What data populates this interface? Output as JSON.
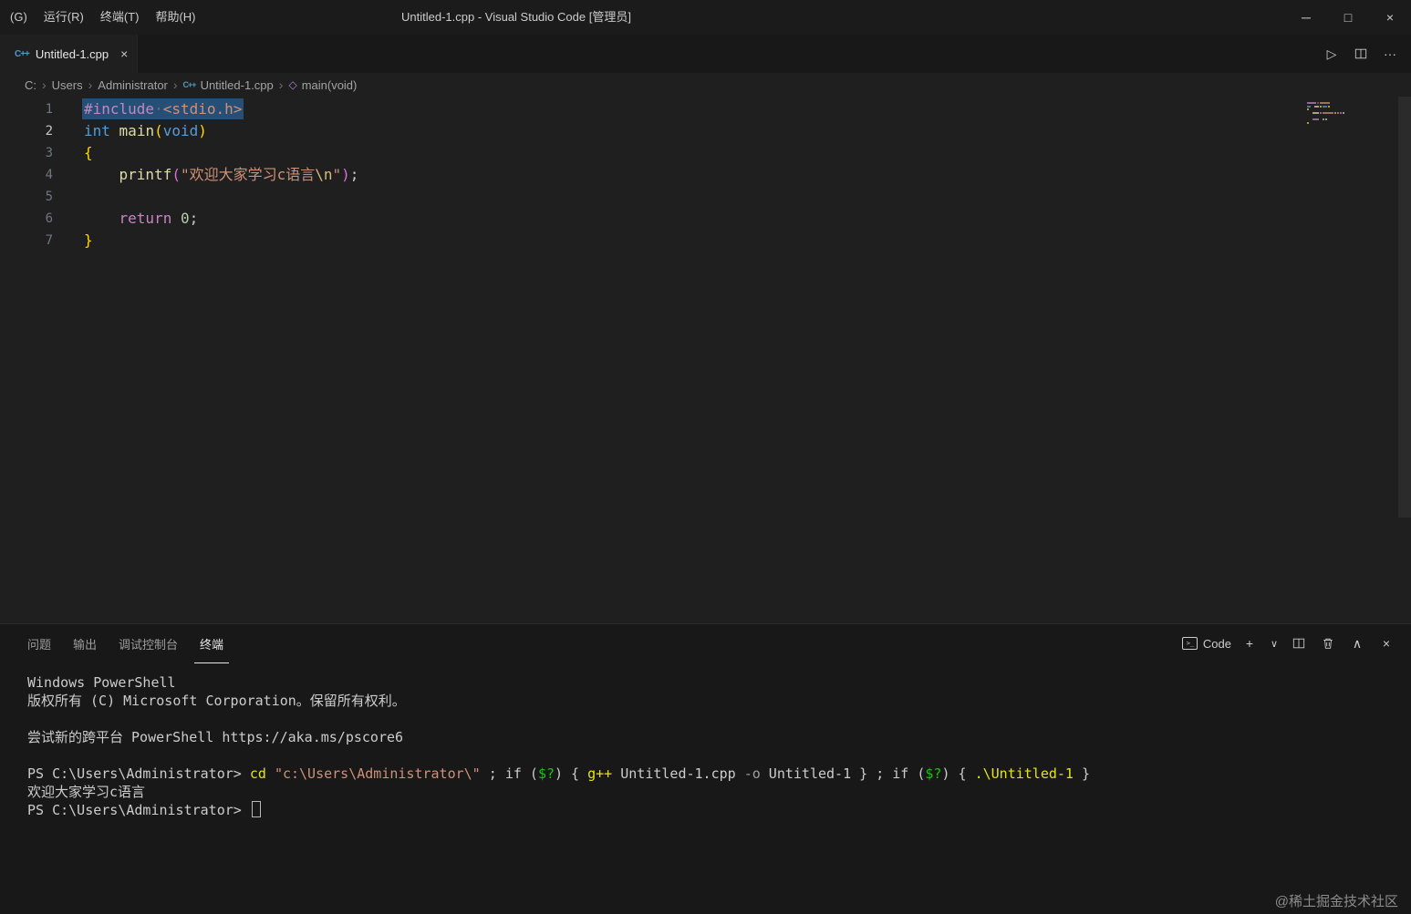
{
  "icons": {
    "cpp": "C++",
    "method": "◇",
    "separator": "›",
    "terminal_glyph": ">_"
  },
  "title_bar": {
    "menus": [
      {
        "label": "(G)"
      },
      {
        "label": "运行(R)"
      },
      {
        "label": "终端(T)"
      },
      {
        "label": "帮助(H)"
      }
    ],
    "title": "Untitled-1.cpp - Visual Studio Code [管理员]",
    "controls": {
      "minimize": "─",
      "maximize": "□",
      "close": "×"
    }
  },
  "tab_bar": {
    "tabs": [
      {
        "label": "Untitled-1.cpp",
        "icon": "cpp",
        "close": "×",
        "active": true
      }
    ],
    "actions": {
      "run": "▷",
      "more": "···"
    }
  },
  "breadcrumb": [
    {
      "label": "C:"
    },
    {
      "label": "Users"
    },
    {
      "label": "Administrator"
    },
    {
      "label": "Untitled-1.cpp",
      "icon": "cpp"
    },
    {
      "label": "main(void)",
      "icon": "method"
    }
  ],
  "editor": {
    "token_colors": {
      "macro": "#c586c0",
      "keyword": "#569cd6",
      "control": "#c586c0",
      "function": "#dcdcaa",
      "string": "#ce9178",
      "escape": "#d7ba7d",
      "number": "#b5cea8",
      "plain": "#cccccc",
      "ws": "#6e6e6e",
      "bracket1": "#ffd700",
      "bracket2": "#da70d6"
    },
    "lines": [
      {
        "num": 1,
        "selected": true,
        "tokens": [
          [
            "#include",
            "macro"
          ],
          [
            "·",
            "ws"
          ],
          [
            "<stdio.h>",
            "string"
          ]
        ]
      },
      {
        "num": 2,
        "active": true,
        "tokens": [
          [
            "int",
            "keyword"
          ],
          [
            " ",
            "plain"
          ],
          [
            "main",
            "function"
          ],
          [
            "(",
            "bracket1"
          ],
          [
            "void",
            "keyword"
          ],
          [
            ")",
            "bracket1"
          ]
        ]
      },
      {
        "num": 3,
        "tokens": [
          [
            "{",
            "bracket1"
          ]
        ]
      },
      {
        "num": 4,
        "tokens": [
          [
            "    ",
            "plain"
          ],
          [
            "printf",
            "function"
          ],
          [
            "(",
            "bracket2"
          ],
          [
            "\"欢迎大家学习c语言",
            "string"
          ],
          [
            "\\n",
            "escape"
          ],
          [
            "\"",
            "string"
          ],
          [
            ")",
            "bracket2"
          ],
          [
            ";",
            "plain"
          ]
        ]
      },
      {
        "num": 5,
        "tokens": []
      },
      {
        "num": 6,
        "tokens": [
          [
            "    ",
            "plain"
          ],
          [
            "return",
            "control"
          ],
          [
            " ",
            "plain"
          ],
          [
            "0",
            "number"
          ],
          [
            ";",
            "plain"
          ]
        ]
      },
      {
        "num": 7,
        "tokens": [
          [
            "}",
            "bracket1"
          ]
        ]
      }
    ]
  },
  "panel": {
    "tabs": [
      {
        "id": "problems",
        "label": "问题",
        "active": false
      },
      {
        "id": "output",
        "label": "输出",
        "active": false
      },
      {
        "id": "debug-console",
        "label": "调试控制台",
        "active": false
      },
      {
        "id": "terminal",
        "label": "终端",
        "active": true
      }
    ],
    "actions": {
      "profile_label": "Code",
      "new": "+",
      "dropdown": "∨",
      "maximize": "∧",
      "close": "×"
    }
  },
  "terminal": {
    "token_colors": {
      "plain": "#cccccc",
      "cmd": "#e5e510",
      "str": "#ce9178",
      "var": "#16c60c",
      "param": "#9d9d9d"
    },
    "lines": [
      {
        "tokens": [
          [
            "Windows PowerShell",
            "plain"
          ]
        ]
      },
      {
        "tokens": [
          [
            "版权所有 (C) Microsoft Corporation。保留所有权利。",
            "plain"
          ]
        ]
      },
      {
        "tokens": []
      },
      {
        "tokens": [
          [
            "尝试新的跨平台 PowerShell https://aka.ms/pscore6",
            "plain"
          ]
        ]
      },
      {
        "tokens": []
      },
      {
        "tokens": [
          [
            "PS C:\\Users\\Administrator> ",
            "plain"
          ],
          [
            "cd",
            "cmd"
          ],
          [
            " ",
            "plain"
          ],
          [
            "\"c:\\Users\\Administrator\\\"",
            "str"
          ],
          [
            " ; ",
            "plain"
          ],
          [
            "if",
            "plain"
          ],
          [
            " (",
            "plain"
          ],
          [
            "$?",
            "var"
          ],
          [
            ") { ",
            "plain"
          ],
          [
            "g++",
            "cmd"
          ],
          [
            " Untitled-1.cpp ",
            "plain"
          ],
          [
            "-o",
            "param"
          ],
          [
            " Untitled-1 } ; ",
            "plain"
          ],
          [
            "if",
            "plain"
          ],
          [
            " (",
            "plain"
          ],
          [
            "$?",
            "var"
          ],
          [
            ") { ",
            "plain"
          ],
          [
            ".\\Untitled-1",
            "cmd"
          ],
          [
            " }",
            "plain"
          ]
        ]
      },
      {
        "tokens": [
          [
            "欢迎大家学习c语言",
            "plain"
          ]
        ]
      },
      {
        "tokens": [
          [
            "PS C:\\Users\\Administrator> ",
            "plain"
          ]
        ],
        "cursor": true
      }
    ]
  },
  "watermark": "@稀土掘金技术社区"
}
